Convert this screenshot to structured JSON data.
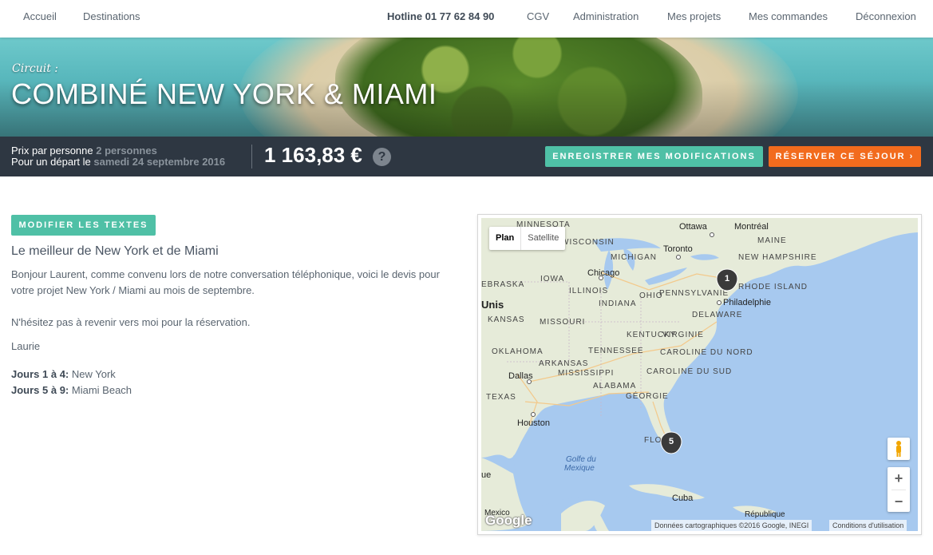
{
  "nav": {
    "home": "Accueil",
    "destinations": "Destinations",
    "hotline": "Hotline 01 77 62 84 90",
    "cgv": "CGV",
    "admin": "Administration",
    "projects": "Mes projets",
    "orders": "Mes commandes",
    "logout": "Déconnexion"
  },
  "hero": {
    "kicker": "Circuit :",
    "title": "COMBINÉ NEW YORK & MIAMI"
  },
  "price": {
    "per_person_label": "Prix par personne",
    "persons": "2 personnes",
    "departure_label": "Pour un départ le",
    "departure_date": "samedi 24 septembre 2016",
    "amount": "1 163,83 €",
    "help_glyph": "?",
    "save_button": "ENREGISTRER MES MODIFICATIONS",
    "book_button": "RÉSERVER CE SÉJOUR ›"
  },
  "content": {
    "modify_button": "MODIFIER LES TEXTES",
    "title": "Le meilleur de New York et de Miami",
    "intro": "Bonjour Laurent, comme convenu lors de notre conversation téléphonique, voici le devis pour votre projet New York / Miami au mois de septembre.",
    "closing": "N'hésitez pas à revenir vers moi pour la réservation.",
    "signature": "Laurie",
    "days": [
      {
        "label": "Jours 1 à 4:",
        "place": "New York"
      },
      {
        "label": "Jours 5 à 9:",
        "place": "Miami Beach"
      }
    ]
  },
  "map": {
    "type_plan": "Plan",
    "type_satellite": "Satellite",
    "zoom_in": "+",
    "zoom_out": "−",
    "markers": [
      "1",
      "5"
    ],
    "labels": {
      "minnesota": "MINNESOTA",
      "ottawa": "Ottawa",
      "montreal": "Montréal",
      "maine": "MAINE",
      "wisconsin": "WISCONSIN",
      "toronto": "Toronto",
      "michigan": "MICHIGAN",
      "new_hampshire": "NEW HAMPSHIRE",
      "nebraska": "EBRASKA",
      "iowa": "IOWA",
      "chicago": "Chicago",
      "rhode_island": "RHODE ISLAND",
      "unis": "Unis",
      "illinois": "ILLINOIS",
      "ohio": "OHIO",
      "pennsylvania": "PENNSYLVANIE",
      "philadelphia": "Philadelphie",
      "indiana": "INDIANA",
      "kansas": "KANSAS",
      "missouri": "MISSOURI",
      "delaware": "DELAWARE",
      "kentucky": "KENTUCKY",
      "virginia": "VIRGINIE",
      "oklahoma": "OKLAHOMA",
      "tennessee": "TENNESSEE",
      "north_carolina": "CAROLINE DU NORD",
      "arkansas": "ARKANSAS",
      "dallas": "Dallas",
      "mississippi": "MISSISSIPPI",
      "south_carolina": "CAROLINE DU SUD",
      "alabama": "ALABAMA",
      "texas": "TEXAS",
      "georgia": "GÉORGIE",
      "houston": "Houston",
      "florida": "FLO",
      "gulf": "Golfe du",
      "mexique": "Mexique",
      "cuba": "Cuba",
      "mexico": "Mexico",
      "republique": "République",
      "ue": "ue"
    },
    "google": "Google",
    "attribution": "Données cartographiques ©2016 Google, INEGI",
    "terms": "Conditions d'utilisation"
  }
}
